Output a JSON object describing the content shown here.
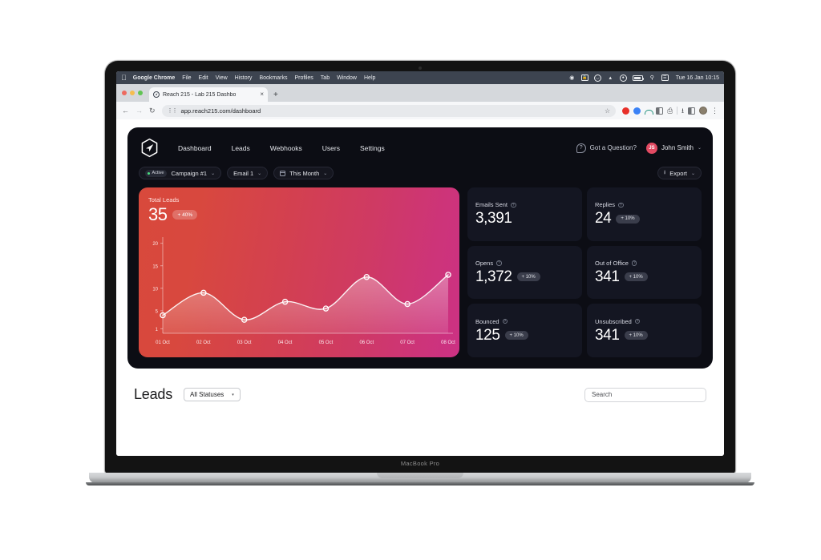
{
  "os": {
    "apple_logo": "apple-logo",
    "menus": [
      "Google Chrome",
      "File",
      "Edit",
      "View",
      "History",
      "Bookmarks",
      "Profiles",
      "Tab",
      "Window",
      "Help"
    ],
    "status_icons": [
      "screen-record-icon",
      "lock-icon",
      "headphones-icon",
      "wifi-icon",
      "control-center-icon",
      "battery-icon",
      "spotlight-search-icon",
      "notification-center-icon"
    ],
    "clock": "Tue 16 Jan  10:15"
  },
  "browser": {
    "tab_title": "Reach 215 - Lab 215 Dashbo",
    "tab_close": "×",
    "new_tab": "+",
    "back": "←",
    "forward": "→",
    "reload": "↻",
    "url": "app.reach215.com/dashboard",
    "star": "☆",
    "kebab": "⋮",
    "extension_icons": [
      "opera-extension-icon",
      "blue-dot-extension-icon",
      "nord-vpn-icon",
      "grammarly-icon",
      "clipboard-icon",
      "downloads-icon",
      "side-panel-icon",
      "profile-avatar-icon"
    ]
  },
  "app": {
    "logo": "paper-plane-hex-logo",
    "nav": [
      {
        "label": "Dashboard"
      },
      {
        "label": "Leads"
      },
      {
        "label": "Webhooks"
      },
      {
        "label": "Users"
      },
      {
        "label": "Settings"
      }
    ],
    "help": {
      "icon": "question-mark-icon",
      "label": "Got a Question?"
    },
    "user": {
      "initials": "JS",
      "name": "John Smith",
      "caret": "⌄"
    }
  },
  "filters": {
    "campaign": {
      "status_badge": "Active",
      "label": "Campaign #1",
      "caret": "⌄"
    },
    "email": {
      "label": "Email 1",
      "caret": "⌄"
    },
    "period": {
      "icon": "calendar-icon",
      "label": "This Month",
      "caret": "⌄"
    },
    "export": {
      "icon": "download-icon",
      "label": "Export",
      "caret": "⌄"
    }
  },
  "chart_data": {
    "type": "line",
    "title": "Total Leads",
    "value": "35",
    "delta": "+ 40%",
    "xlabel": "",
    "ylabel": "",
    "categories": [
      "01 Oct",
      "02 Oct",
      "03 Oct",
      "04 Oct",
      "05 Oct",
      "06 Oct",
      "07 Oct",
      "08 Oct"
    ],
    "values": [
      4,
      9,
      3,
      7,
      5.5,
      12.5,
      6.5,
      13
    ],
    "yticks": [
      1,
      5,
      10,
      15,
      20
    ],
    "ylim": [
      0,
      21
    ],
    "grid": false,
    "legend": "none",
    "gradient_from": "#d8493c",
    "gradient_to": "#cc3184"
  },
  "stats": [
    {
      "label": "Emails Sent",
      "info": "info-icon",
      "value": "3,391",
      "delta": null
    },
    {
      "label": "Replies",
      "info": "info-icon",
      "value": "24",
      "delta": "+ 10%"
    },
    {
      "label": "Opens",
      "info": "info-icon",
      "value": "1,372",
      "delta": "+ 10%"
    },
    {
      "label": "Out of Office",
      "info": "info-icon",
      "value": "341",
      "delta": "+ 10%"
    },
    {
      "label": "Bounced",
      "info": "info-icon",
      "value": "125",
      "delta": "+ 10%"
    },
    {
      "label": "Unsubscribed",
      "info": "info-icon",
      "value": "341",
      "delta": "+ 10%"
    }
  ],
  "leads": {
    "title": "Leads",
    "status_filter": {
      "label": "All Statuses",
      "caret": "▾"
    },
    "search_placeholder": "Search"
  },
  "device": {
    "label": "MacBook Pro"
  }
}
